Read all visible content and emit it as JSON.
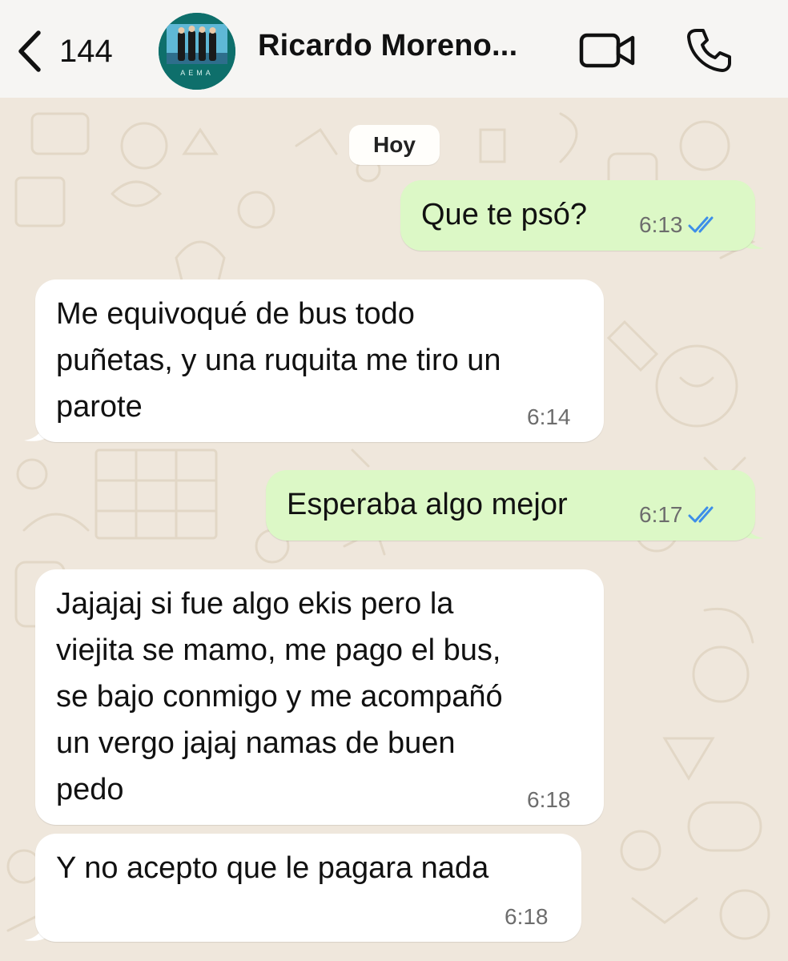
{
  "header": {
    "back_count": "144",
    "contact_name": "Ricardo Moreno...",
    "avatar_caption": "AEMA"
  },
  "chat": {
    "day_label": "Hoy",
    "messages": [
      {
        "direction": "out",
        "text": "Que te psó?",
        "time": "6:13",
        "status": "read"
      },
      {
        "direction": "in",
        "text": "Me equivoqué de bus todo\npuñetas, y una ruquita me tiro un\nparote",
        "time": "6:14"
      },
      {
        "direction": "out",
        "text": "Esperaba algo mejor",
        "time": "6:17",
        "status": "read"
      },
      {
        "direction": "in",
        "text": "Jajajaj si fue algo ekis pero la\nviejita se mamo, me pago el bus,\nse bajo conmigo y me acompañó\nun vergo jajaj namas de buen\npedo",
        "time": "6:18"
      },
      {
        "direction": "in",
        "text": "Y no acepto que le pagara nada",
        "time": "6:18"
      }
    ]
  },
  "colors": {
    "outgoing_bubble": "#dcf8c6",
    "incoming_bubble": "#ffffff",
    "chat_background": "#efe7dc",
    "read_ticks": "#3d8ee8",
    "header_background": "#f6f5f3"
  },
  "icons": [
    "chevron-left-icon",
    "video-call-icon",
    "phone-call-icon",
    "double-check-icon"
  ]
}
